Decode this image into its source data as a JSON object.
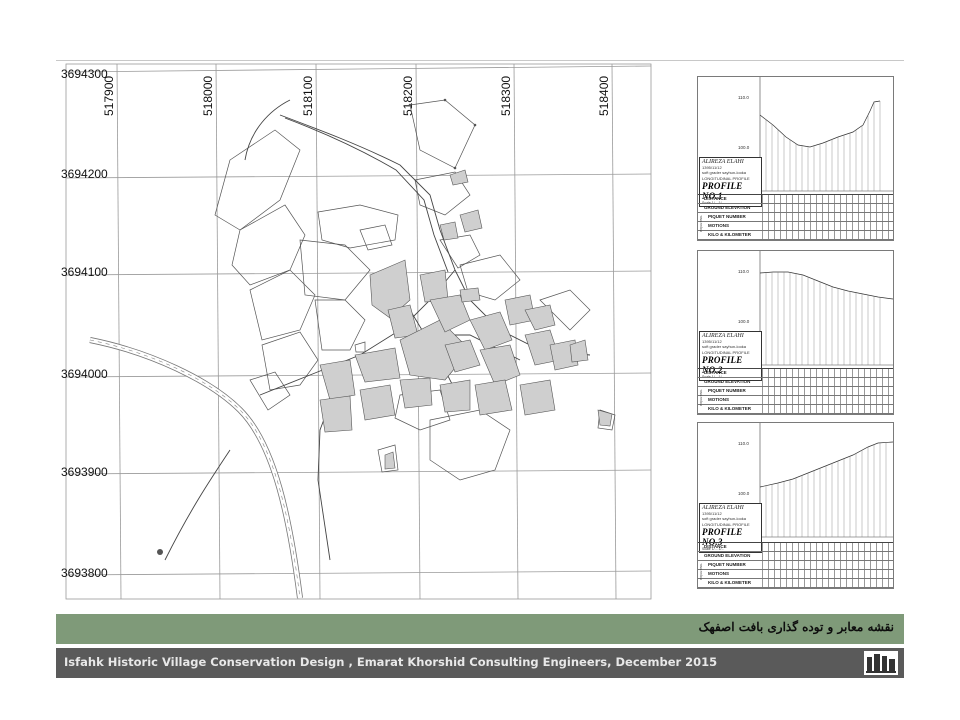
{
  "map": {
    "y_labels": [
      "3694300",
      "3694200",
      "3694100",
      "3694000",
      "3693900",
      "3693800"
    ],
    "x_labels": [
      "517900",
      "518000",
      "518100",
      "518200",
      "518300",
      "518400"
    ]
  },
  "profiles": [
    {
      "elev_top": "110.0",
      "elev_bottom": "100.0",
      "author": "ALIREZA  ELAHI",
      "date": "1395/11/12",
      "note": "soft grader sayhun-looka",
      "type": "LONGITUDINAL PROFILE",
      "name": "PROFILE NO.1",
      "scale": "Scale 1/...   1/...",
      "rows": [
        "DISTANCE",
        "GROUND ELEVATION",
        "PIQUET NUMBER",
        "MOTIONS",
        "KILO & KILOMETER"
      ],
      "side": "PIQUETING"
    },
    {
      "elev_top": "110.0",
      "elev_bottom": "100.0",
      "author": "ALIREZA  ELAHI",
      "date": "1395/11/12",
      "note": "soft grader sayhun-looka",
      "type": "LONGITUDINAL PROFILE",
      "name": "PROFILE NO.2",
      "scale": "Scale 1/...   1/...",
      "rows": [
        "DISTANCE",
        "GROUND ELEVATION",
        "PIQUET NUMBER",
        "MOTIONS",
        "KILO & KILOMETER"
      ],
      "side": "PIQUETING"
    },
    {
      "elev_top": "110.0",
      "elev_bottom": "100.0",
      "author": "ALIREZA  ELAHI",
      "date": "1395/11/12",
      "note": "soft grader sayhun-looka",
      "type": "LONGITUDINAL PROFILE",
      "name": "PROFILE NO.3",
      "scale": "Scale 1/...   1/...",
      "rows": [
        "DISTANCE",
        "GROUND ELEVATION",
        "PIQUET NUMBER",
        "MOTIONS",
        "KILO & KILOMETER"
      ],
      "side": "PIQUETING"
    }
  ],
  "caption": "نقشه معابر و توده گذاری بافت اصفهک",
  "footer": "Isfahk Historic Village Conservation Design , Emarat Khorshid Consulting Engineers, December 2015",
  "logo_icon": "building-logo-icon"
}
